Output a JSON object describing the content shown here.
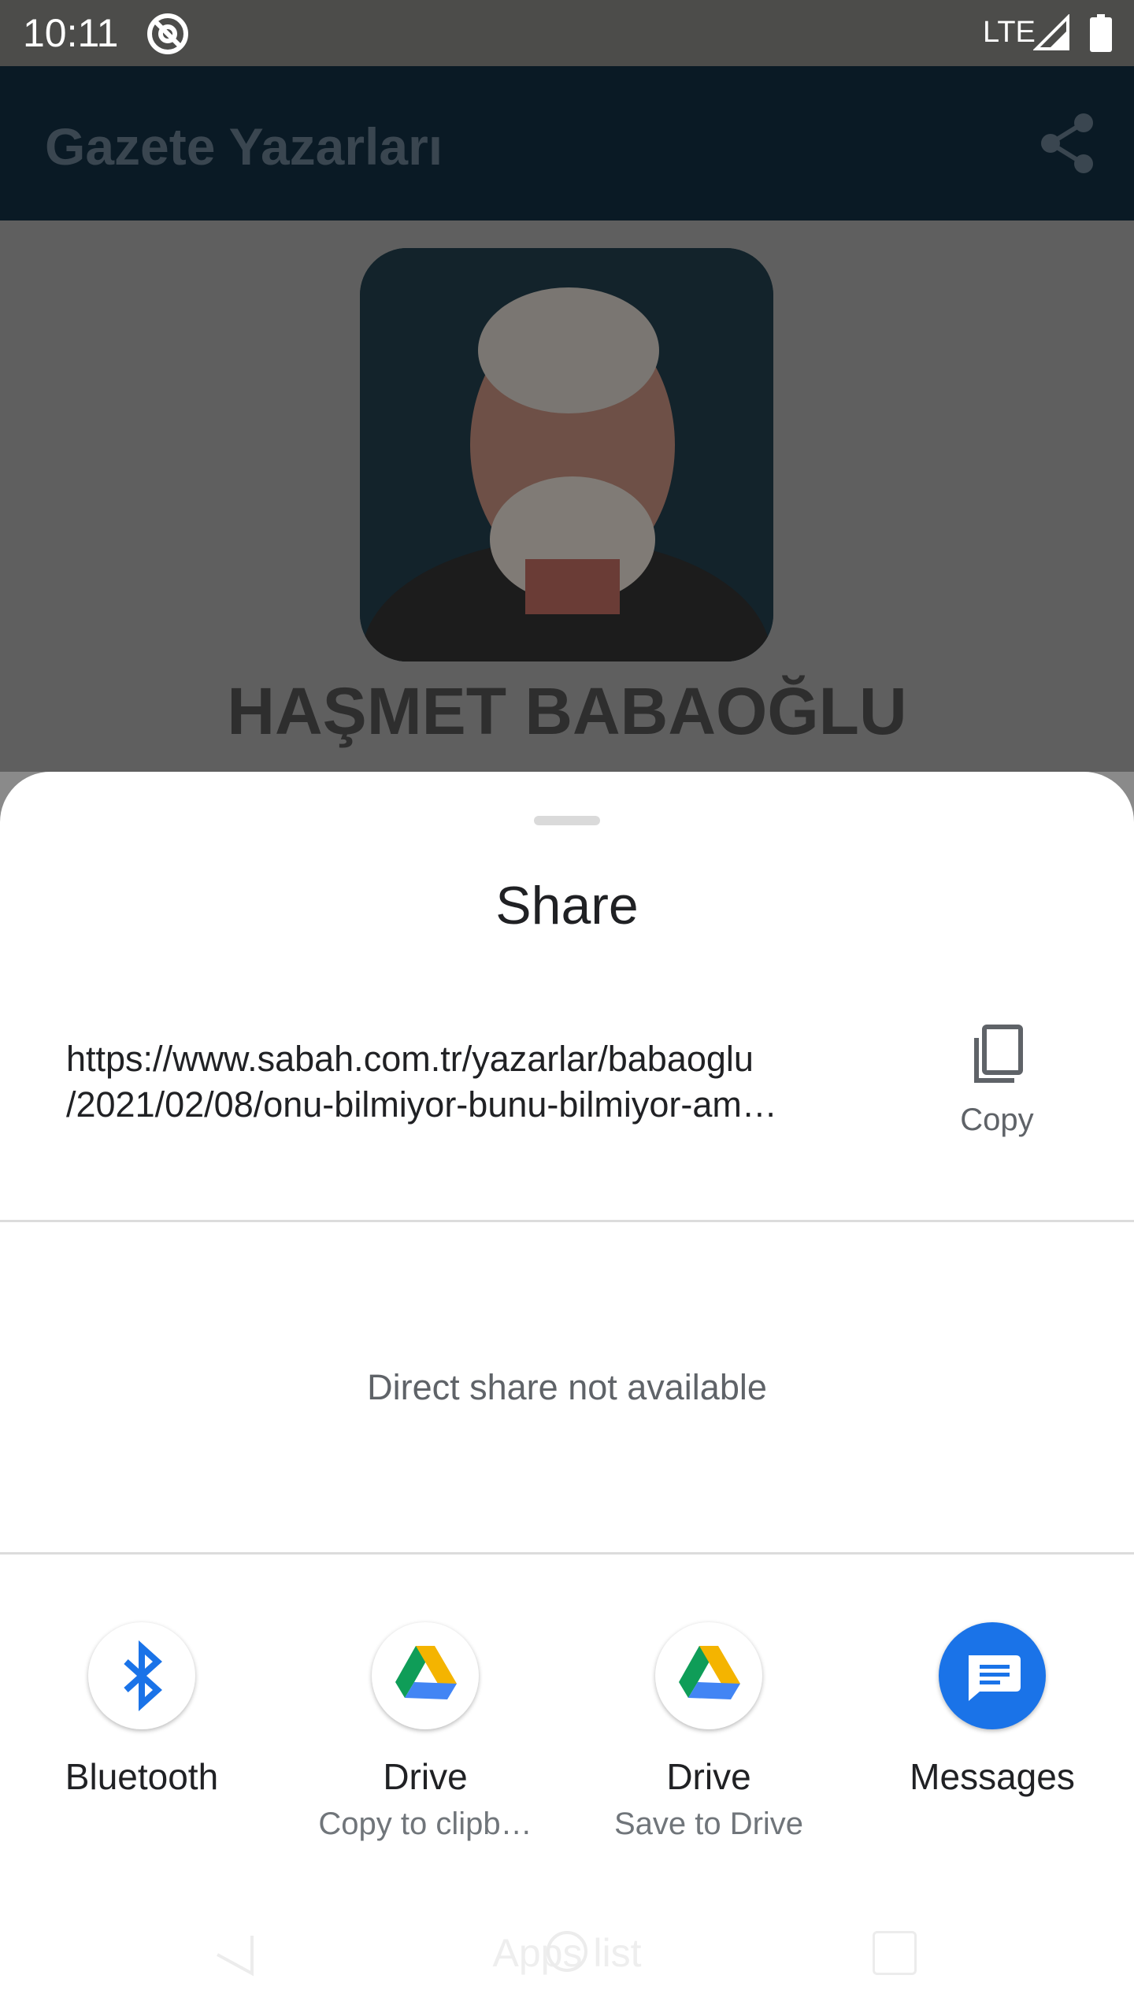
{
  "status_bar": {
    "time": "10:11",
    "network": "LTE"
  },
  "app_bar": {
    "title": "Gazete Yazarları",
    "share_icon": "share-icon"
  },
  "author": {
    "name": "HAŞMET BABAOĞLU"
  },
  "share_sheet": {
    "title": "Share",
    "url_line1": "https://www.sabah.com.tr/yazarlar/babaoglu",
    "url_line2": "/2021/02/08/onu-bilmiyor-bunu-bilmiyor-am…",
    "copy_label": "Copy",
    "direct_share_text": "Direct share not available",
    "targets": [
      {
        "label": "Bluetooth",
        "sub": "",
        "icon": "bluetooth-icon"
      },
      {
        "label": "Drive",
        "sub": "Copy to clipb…",
        "icon": "drive-icon"
      },
      {
        "label": "Drive",
        "sub": "Save to Drive",
        "icon": "drive-icon"
      },
      {
        "label": "Messages",
        "sub": "",
        "icon": "messages-icon"
      }
    ]
  },
  "nav_bar": {
    "label": "Apps list"
  },
  "colors": {
    "status_bar": "#4c4c4a",
    "app_bar": "#0a1a25",
    "sheet": "#ffffff",
    "accent_blue": "#1a73e8"
  }
}
